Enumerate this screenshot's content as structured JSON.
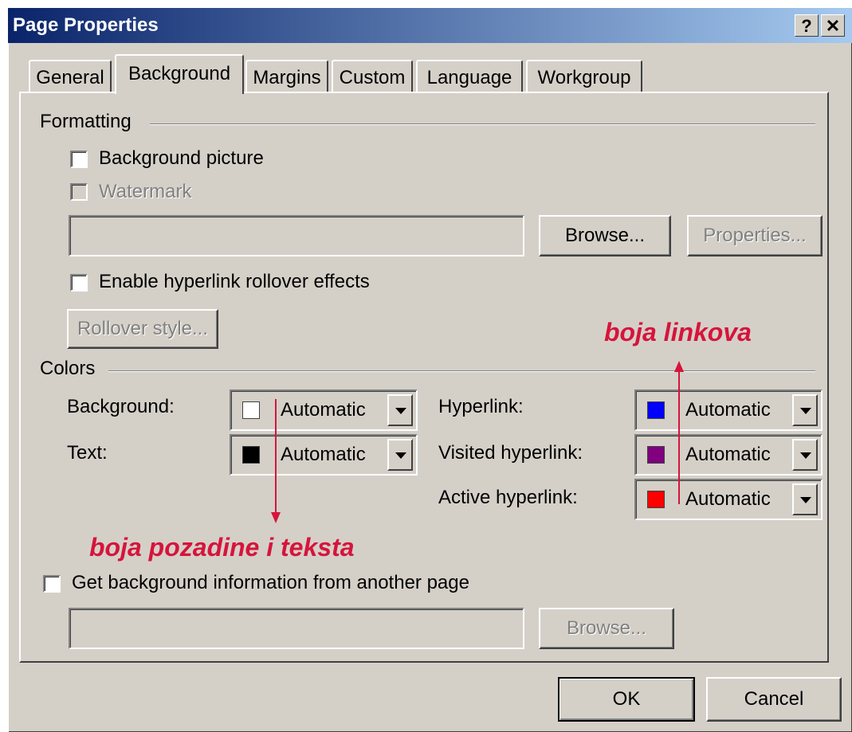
{
  "window": {
    "title": "Page Properties",
    "help_label": "?",
    "close_label": "✕"
  },
  "tabs": [
    {
      "label": "General",
      "active": false
    },
    {
      "label": "Background",
      "active": true
    },
    {
      "label": "Margins",
      "active": false
    },
    {
      "label": "Custom",
      "active": false
    },
    {
      "label": "Language",
      "active": false
    },
    {
      "label": "Workgroup",
      "active": false
    }
  ],
  "formatting": {
    "group_label": "Formatting",
    "background_picture_label": "Background picture",
    "background_picture_checked": false,
    "watermark_label": "Watermark",
    "watermark_checked": false,
    "picture_path": "",
    "browse_label": "Browse...",
    "properties_label": "Properties...",
    "rollover_label": "Enable hyperlink rollover effects",
    "rollover_checked": false,
    "rollover_style_label": "Rollover style..."
  },
  "colors": {
    "group_label": "Colors",
    "background": {
      "label": "Background:",
      "value": "Automatic",
      "swatch": "#ffffff"
    },
    "text": {
      "label": "Text:",
      "value": "Automatic",
      "swatch": "#000000"
    },
    "hyperlink": {
      "label": "Hyperlink:",
      "value": "Automatic",
      "swatch": "#0000ff"
    },
    "visited_hyperlink": {
      "label": "Visited hyperlink:",
      "value": "Automatic",
      "swatch": "#800080"
    },
    "active_hyperlink": {
      "label": "Active hyperlink:",
      "value": "Automatic",
      "swatch": "#ff0000"
    }
  },
  "other_page": {
    "label": "Get background information from another page",
    "checked": false,
    "path": "",
    "browse_label": "Browse..."
  },
  "footer": {
    "ok_label": "OK",
    "cancel_label": "Cancel"
  },
  "annotations": {
    "links_note": "boja linkova",
    "background_text_note": "boja pozadine i teksta",
    "color": "#d6143c"
  }
}
